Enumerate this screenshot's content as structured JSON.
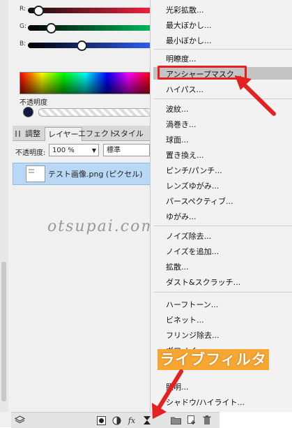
{
  "color_sliders": [
    {
      "label": "R:",
      "value": 0.1,
      "gradient": [
        "#101010",
        "#ff2040"
      ]
    },
    {
      "label": "G:",
      "value": 0.18,
      "gradient": [
        "#000000",
        "#00c060"
      ]
    },
    {
      "label": "B:",
      "value": 0.41,
      "gradient": [
        "#000000",
        "#3060ff"
      ]
    }
  ],
  "opacity_label": "不透明度",
  "tabs": [
    "調整",
    "レイヤー",
    "エフェクト",
    "スタイル"
  ],
  "layer_controls": {
    "opacity_label": "不透明度:",
    "opacity_value": "100 %",
    "blend_mode": "標準"
  },
  "layer": {
    "name": "テスト画像.png (ピクセル)"
  },
  "watermark": "otsupai.com",
  "menu_items": [
    "光彩拡散...",
    "最大ぼかし...",
    "最小ぼかし...",
    "明瞭度...",
    "アンシャープマスク...",
    "ハイパス...",
    "波紋...",
    "渦巻き...",
    "球面...",
    "置き換え...",
    "ピンチ/パンチ...",
    "レンズゆがみ...",
    "パースペクティブ...",
    "ゆがみ...",
    "ノイズ除去...",
    "ノイズを追加...",
    "拡散...",
    "ダスト&スクラッチ...",
    "ハーフトーン...",
    "ビネット...",
    "フリンジ除去...",
    "ボロノイ...",
    "",
    "照明...",
    "シャドウ/ハイライト..."
  ],
  "highlighted_item": "アンシャープマスク...",
  "callout_label": "ライブフィルタ",
  "bottom_icons": [
    "layers-icon",
    "mask-icon",
    "adjustment-icon",
    "fx-icon",
    "live-filter-icon",
    "folder-icon",
    "new-layer-icon",
    "trash-icon"
  ],
  "colors": {
    "highlight_box": "#e42020",
    "callout_bg": "#f7a632",
    "arrow": "#e42020",
    "selected_layer": "#b8d8f5"
  }
}
